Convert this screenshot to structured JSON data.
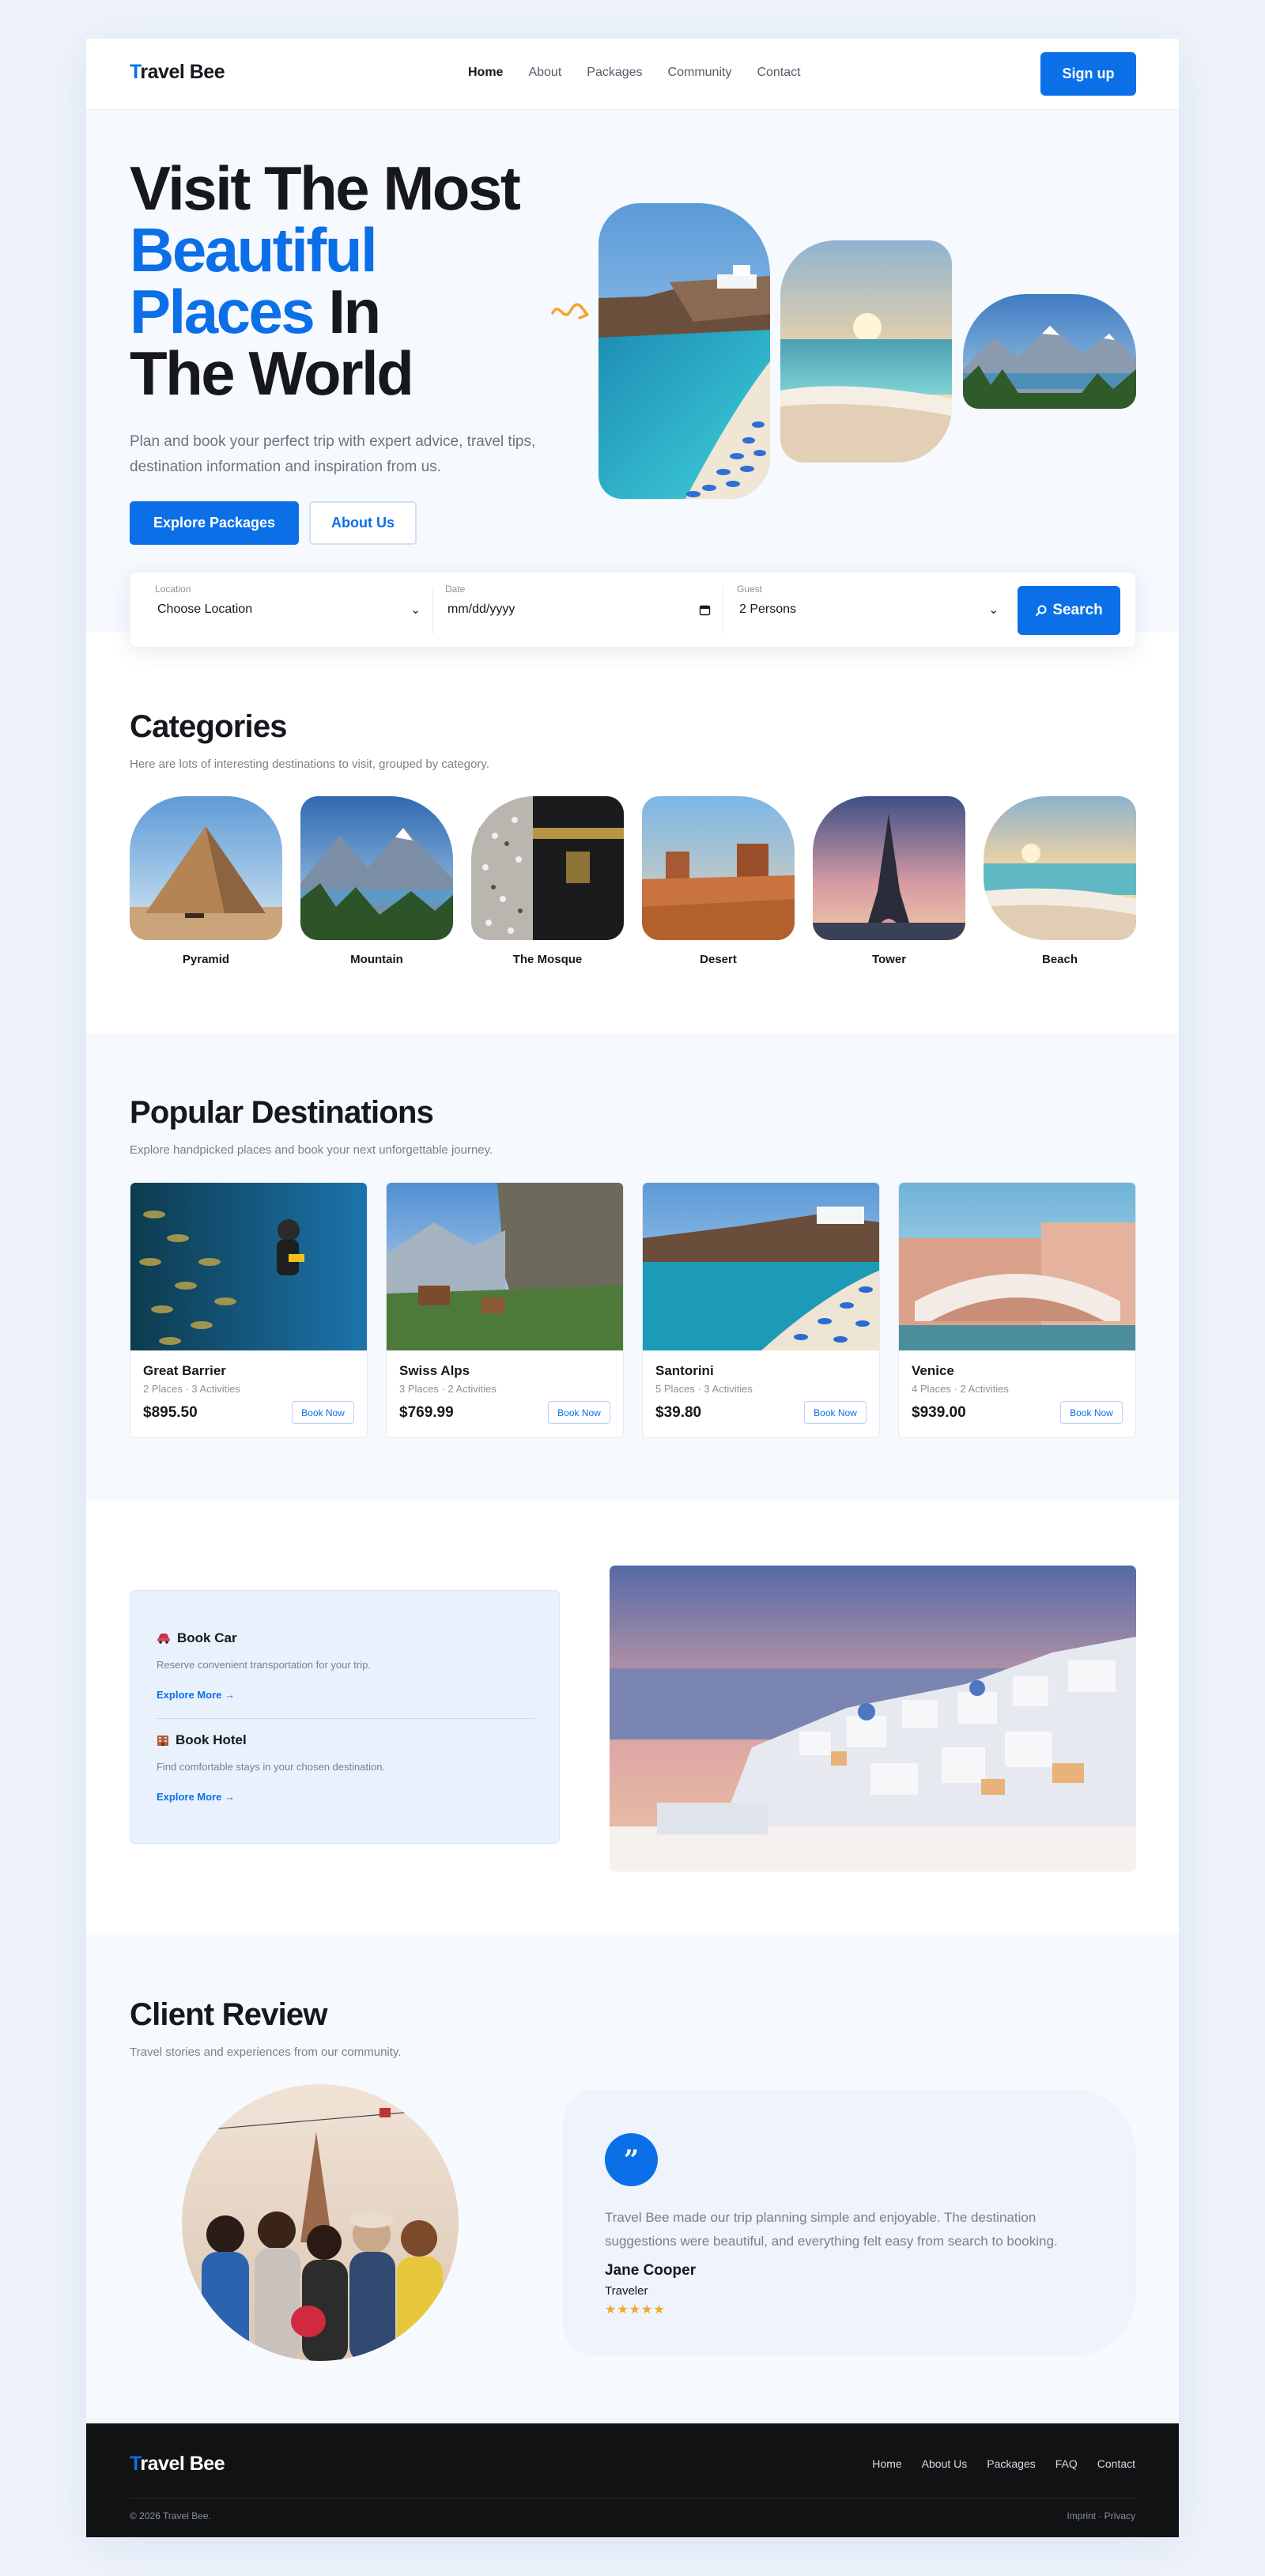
{
  "nav": {
    "logo_first": "T",
    "logo_rest": "ravel Bee",
    "links": [
      "Home",
      "About",
      "Packages",
      "Community",
      "Contact"
    ],
    "signup": "Sign up"
  },
  "hero": {
    "title_line1": "Visit The Most",
    "title_line2": "Beautiful",
    "title_line3a": "Places",
    "title_line3b": " In",
    "title_line4": "The World",
    "subtitle": "Plan and book your perfect trip with expert advice, travel tips, destination information and inspiration from us.",
    "btn_primary": "Explore Packages",
    "btn_secondary": "About Us"
  },
  "search": {
    "location_label": "Location",
    "location_value": "Choose Location",
    "date_label": "Date",
    "date_value": "mm/dd/yyyy",
    "guest_label": "Guest",
    "guest_value": "2 Persons",
    "button": "Search"
  },
  "categories": {
    "title": "Categories",
    "subtitle": "Here are lots of interesting destinations to visit, grouped by category.",
    "items": [
      "Pyramid",
      "Mountain",
      "The Mosque",
      "Desert",
      "Tower",
      "Beach"
    ]
  },
  "popular": {
    "title": "Popular Destinations",
    "subtitle": "Explore handpicked places and book your next unforgettable journey.",
    "cards": [
      {
        "name": "Great Barrier",
        "meta": "2 Places · 3 Activities",
        "price": "$895.50",
        "book": "Book Now"
      },
      {
        "name": "Swiss Alps",
        "meta": "3 Places · 2 Activities",
        "price": "$769.99",
        "book": "Book Now"
      },
      {
        "name": "Santorini",
        "meta": "5 Places · 3 Activities",
        "price": "$39.80",
        "book": "Book Now"
      },
      {
        "name": "Venice",
        "meta": "4 Places · 2 Activities",
        "price": "$939.00",
        "book": "Book Now"
      }
    ]
  },
  "services": {
    "car_title": "Book Car",
    "car_desc": "Reserve convenient transportation for your trip.",
    "car_link": "Explore More →",
    "hotel_title": "Book Hotel",
    "hotel_desc": "Find comfortable stays in your chosen destination.",
    "hotel_link": "Explore More →"
  },
  "review": {
    "title": "Client Review",
    "subtitle": "Travel stories and experiences from our community.",
    "quote_mark": "”",
    "text": "Travel Bee made our trip planning simple and enjoyable. The destination suggestions were beautiful, and everything felt easy from search to booking.",
    "name": "Jane Cooper",
    "role": "Traveler",
    "stars": "★★★★★"
  },
  "footer": {
    "logo_first": "T",
    "logo_rest": "ravel Bee",
    "links": [
      "Home",
      "About Us",
      "Packages",
      "FAQ",
      "Contact"
    ],
    "copyright": "© 2026 Travel Bee.",
    "legal": "Imprint · Privacy"
  },
  "colors": {
    "accent": "#0b6fe8",
    "footer_bg": "#111214",
    "star": "#f2a62b"
  }
}
